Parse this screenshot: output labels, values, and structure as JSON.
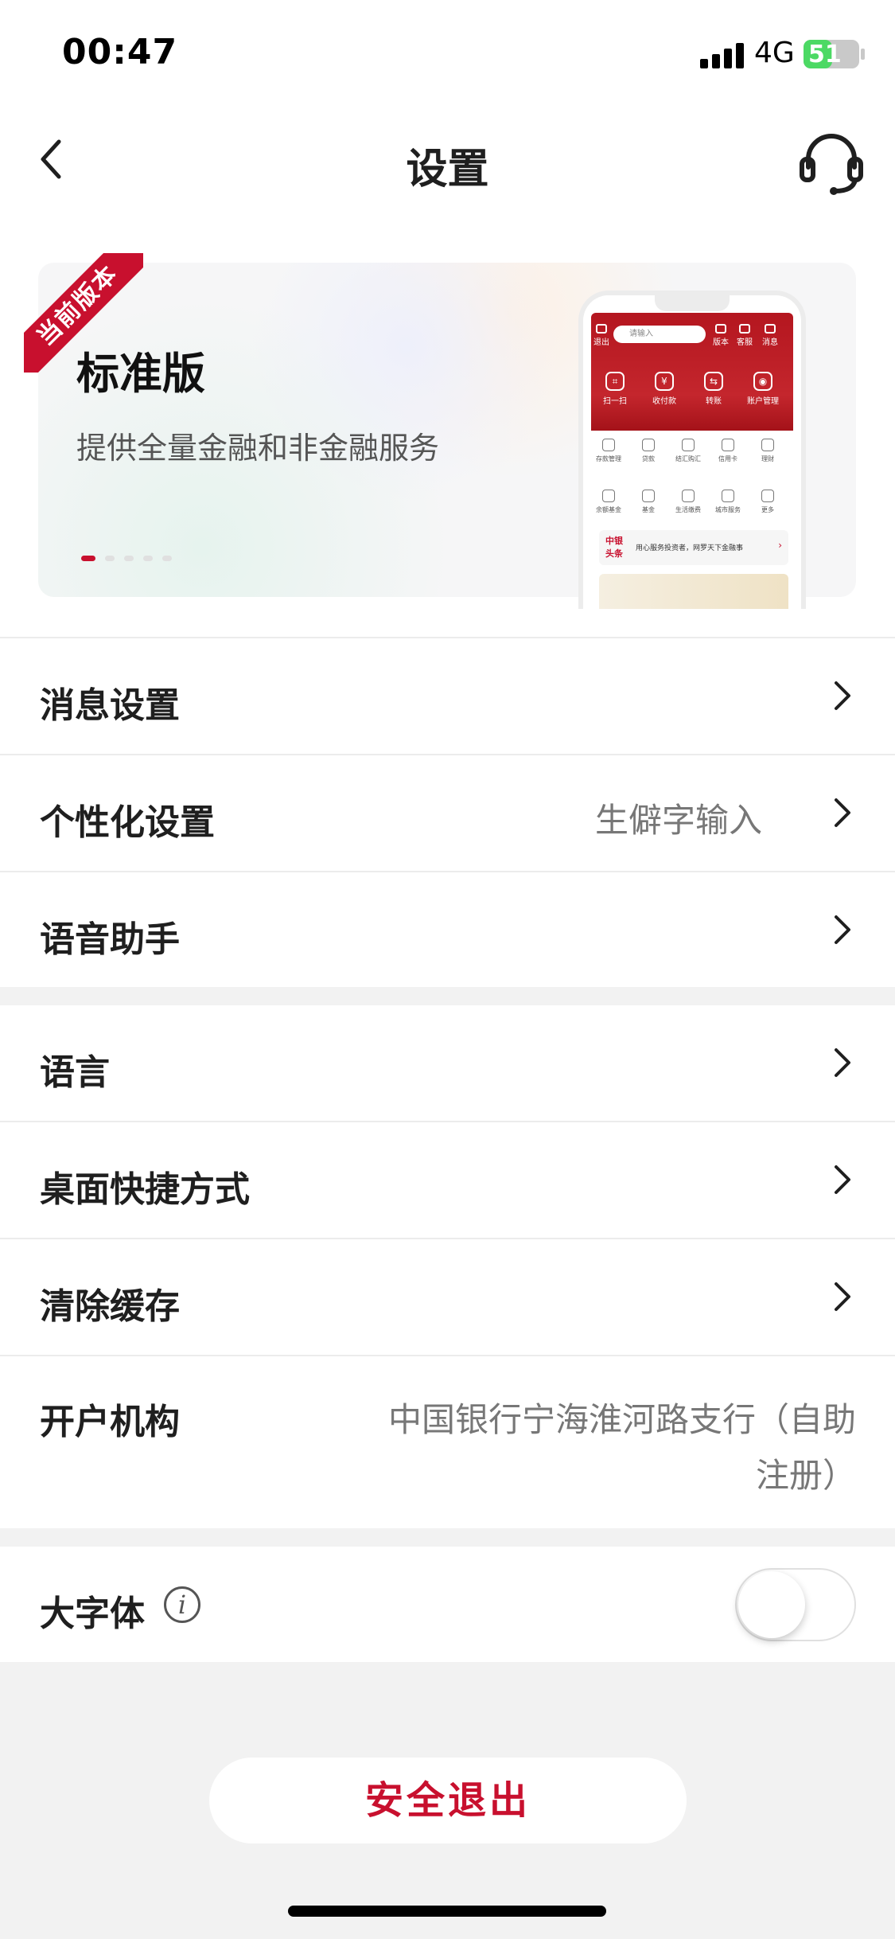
{
  "status_bar": {
    "time": "00:47",
    "network": "4G",
    "battery": "51",
    "battery_level": 0.51
  },
  "nav": {
    "title": "设置",
    "back_icon": "chevron-left-icon",
    "support_icon": "headset-icon"
  },
  "banner": {
    "ribbon": "当前版本",
    "title": "标准版",
    "subtitle": "提供全量金融和非金融服务",
    "page_count": 5,
    "active_page": 1,
    "phone": {
      "search_placeholder": "请输入",
      "top_actions": [
        "退出",
        "版本",
        "客服",
        "消息"
      ],
      "quick_actions": [
        "扫一扫",
        "收付款",
        "转账",
        "账户管理"
      ],
      "grid": [
        "存款管理",
        "贷款",
        "结汇购汇",
        "信用卡",
        "理财",
        "余额基金",
        "基金",
        "生活缴费",
        "城市服务",
        "更多"
      ],
      "news_logo": "中银头条",
      "news_text": "用心服务投资者，网罗天下金融事"
    }
  },
  "settings": {
    "group1": [
      {
        "label": "消息设置",
        "value": ""
      },
      {
        "label": "个性化设置",
        "value": "生僻字输入"
      },
      {
        "label": "语音助手",
        "value": ""
      }
    ],
    "group2": [
      {
        "label": "语言",
        "value": ""
      },
      {
        "label": "桌面快捷方式",
        "value": ""
      },
      {
        "label": "清除缓存",
        "value": ""
      }
    ],
    "account_branch": {
      "label": "开户机构",
      "value_line1": "中国银行宁海淮河路支行（自助",
      "value_line2": "注册）"
    },
    "large_font": {
      "label": "大字体",
      "info_icon": "info-icon",
      "enabled": false
    }
  },
  "logout": {
    "label": "安全退出"
  },
  "colors": {
    "accent": "#c8102e",
    "background": "#f2f2f2",
    "card": "#ffffff"
  }
}
